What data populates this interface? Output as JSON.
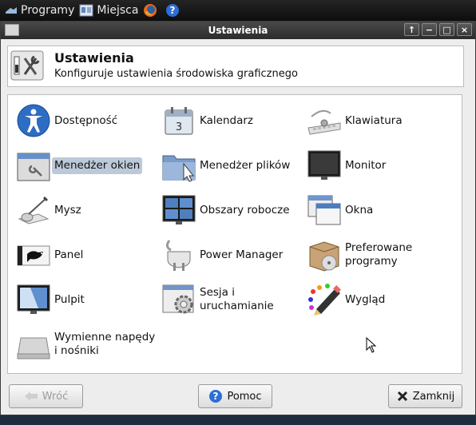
{
  "panel": {
    "apps_label": "Programy",
    "places_label": "Miejsca"
  },
  "window": {
    "title": "Ustawienia",
    "controls": [
      "↑",
      "−",
      "□",
      "×"
    ]
  },
  "header": {
    "title": "Ustawienia",
    "subtitle": "Konfiguruje ustawienia środowiska graficznego"
  },
  "items": [
    {
      "label": "Dostępność",
      "icon": "accessibility-icon"
    },
    {
      "label": "Kalendarz",
      "icon": "calendar-icon"
    },
    {
      "label": "Klawiatura",
      "icon": "keyboard-icon"
    },
    {
      "label": "Menedżer okien",
      "icon": "window-manager-icon",
      "selected": true
    },
    {
      "label": "Menedżer plików",
      "icon": "file-manager-icon"
    },
    {
      "label": "Monitor",
      "icon": "monitor-icon"
    },
    {
      "label": "Mysz",
      "icon": "mouse-icon"
    },
    {
      "label": "Obszary robocze",
      "icon": "workspaces-icon"
    },
    {
      "label": "Okna",
      "icon": "windows-icon"
    },
    {
      "label": "Panel",
      "icon": "panel-icon"
    },
    {
      "label": "Power Manager",
      "icon": "power-plug-icon"
    },
    {
      "label": "Preferowane\nprogramy",
      "icon": "preferred-apps-icon"
    },
    {
      "label": "Pulpit",
      "icon": "desktop-icon"
    },
    {
      "label": "Sesja i\nuruchamianie",
      "icon": "session-gear-icon"
    },
    {
      "label": "Wygląd",
      "icon": "appearance-icon"
    },
    {
      "label": "Wymienne napędy\ni nośniki",
      "icon": "removable-drive-icon"
    }
  ],
  "buttons": {
    "back": "Wróć",
    "help": "Pomoc",
    "close": "Zamknij"
  }
}
